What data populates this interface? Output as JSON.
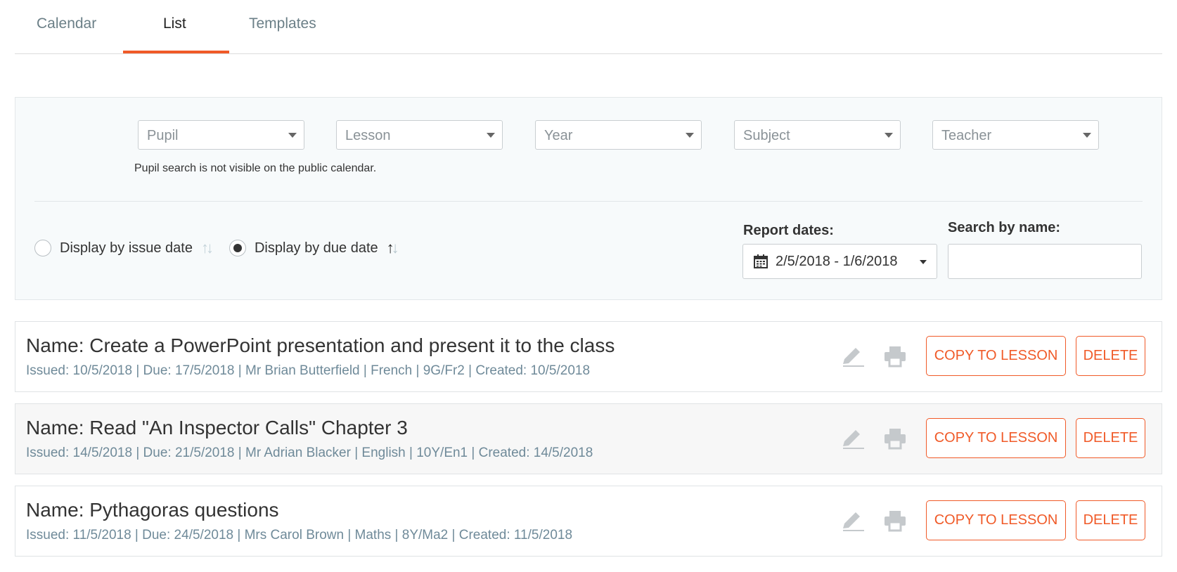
{
  "tabs": [
    {
      "label": "Calendar",
      "active": false
    },
    {
      "label": "List",
      "active": true
    },
    {
      "label": "Templates",
      "active": false
    }
  ],
  "filters": {
    "dropdowns": [
      "Pupil",
      "Lesson",
      "Year",
      "Subject",
      "Teacher"
    ],
    "pupil_note": "Pupil search is not visible on the public calendar.",
    "display_issue_label": "Display by issue date",
    "display_due_label": "Display by due date",
    "selected_display": "due",
    "report_dates_label": "Report dates:",
    "report_dates_value": "2/5/2018 - 1/6/2018",
    "search_label": "Search by name:",
    "search_value": ""
  },
  "homework": [
    {
      "name": "Name: Create a PowerPoint presentation and present it to the class",
      "meta": "Issued: 10/5/2018 | Due: 17/5/2018 | Mr Brian Butterfield | French | 9G/Fr2 | Created: 10/5/2018"
    },
    {
      "name": "Name: Read \"An Inspector Calls\" Chapter 3",
      "meta": "Issued: 14/5/2018 | Due: 21/5/2018 | Mr Adrian Blacker | English | 10Y/En1 | Created: 14/5/2018"
    },
    {
      "name": "Name: Pythagoras questions",
      "meta": "Issued: 11/5/2018 | Due: 24/5/2018 | Mrs Carol Brown | Maths | 8Y/Ma2 | Created: 11/5/2018"
    }
  ],
  "actions": {
    "copy_label": "COPY TO LESSON",
    "delete_label": "DELETE"
  },
  "colors": {
    "accent": "#f05a28",
    "meta_text": "#6f8a99",
    "icon_muted": "#c5c9cc"
  },
  "icons": [
    "pencil-icon",
    "printer-icon",
    "calendar-icon",
    "sort-icon"
  ]
}
